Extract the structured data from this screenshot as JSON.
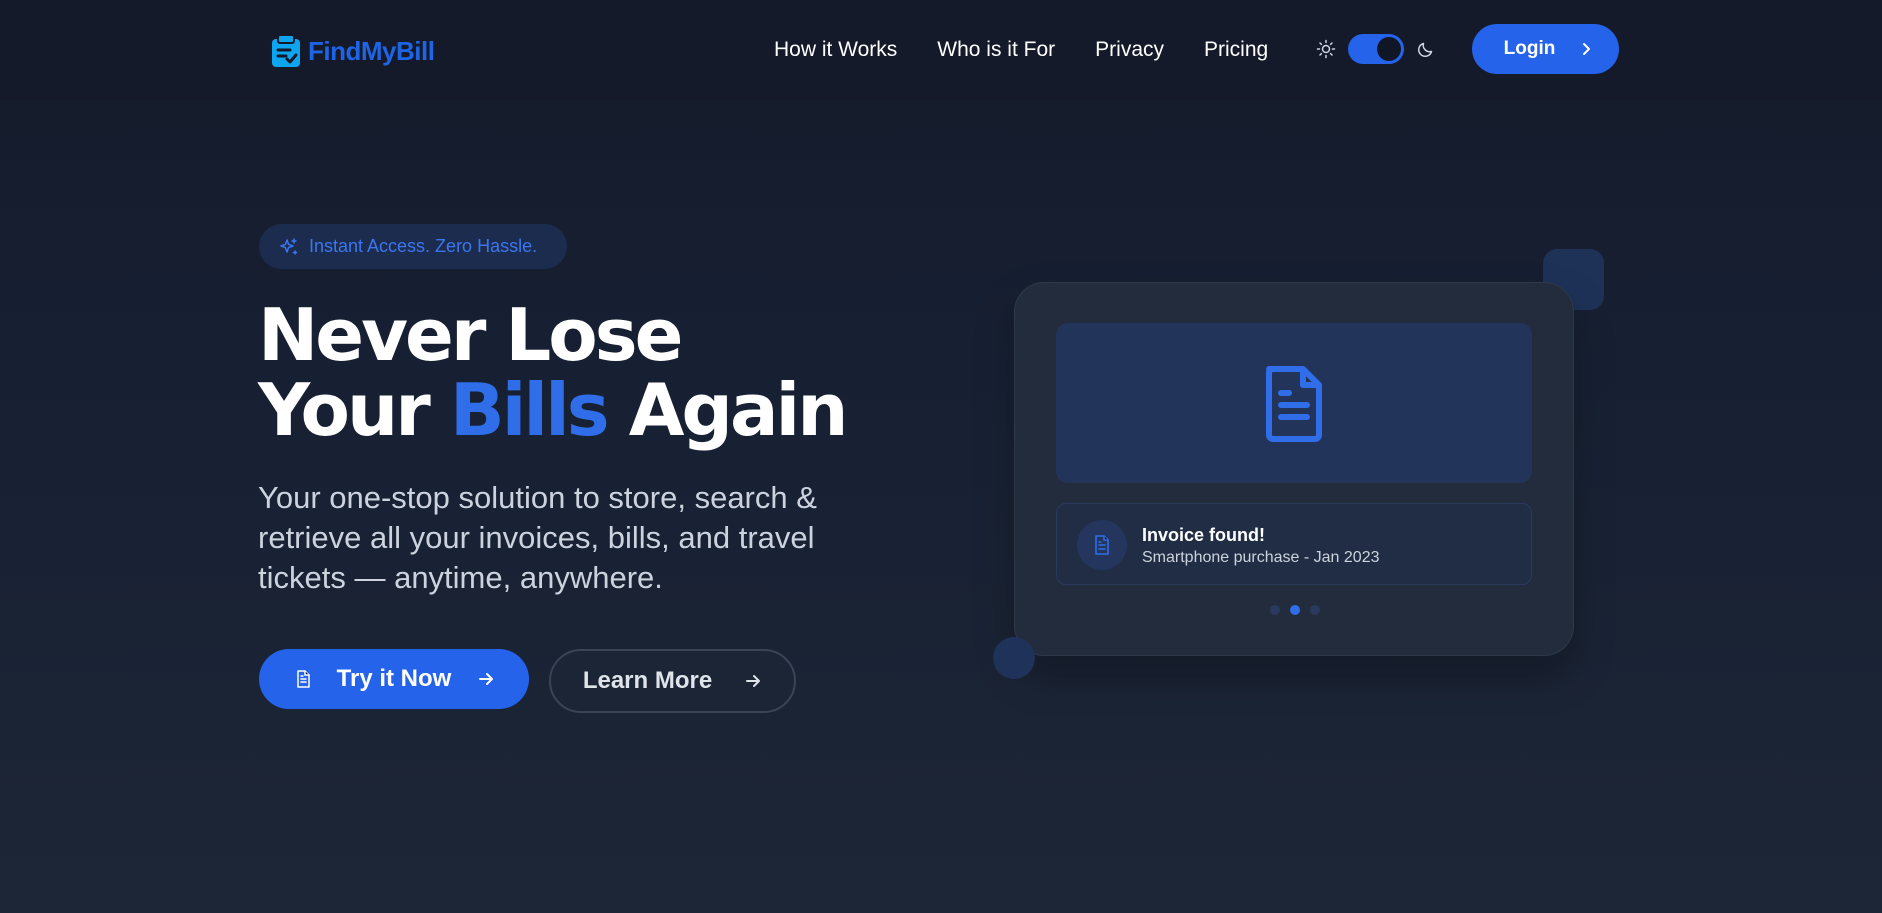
{
  "brand": {
    "name": "FindMyBill",
    "logo_icon": "clipboard-check-icon",
    "accent": "#2563eb"
  },
  "nav": {
    "links": [
      "How it Works",
      "Who is it For",
      "Privacy",
      "Pricing"
    ],
    "theme_toggle": {
      "light_icon": "sun-icon",
      "dark_icon": "moon-icon",
      "mode": "dark"
    },
    "login_label": "Login"
  },
  "hero": {
    "badge": "Instant Access. Zero Hassle.",
    "headline": {
      "line1": "Never Lose",
      "line2_prefix": "Your",
      "line2_accent": "Bills",
      "line2_suffix": "Again"
    },
    "subtext": "Your one-stop solution to store, search & retrieve all your invoices, bills, and travel tickets — anytime, anywhere.",
    "primary_cta": "Try it Now",
    "secondary_cta": "Learn More"
  },
  "preview_card": {
    "result_title": "Invoice found!",
    "result_subtitle": "Smartphone purchase - Jan 2023",
    "carousel": {
      "count": 3,
      "active": 2
    }
  }
}
